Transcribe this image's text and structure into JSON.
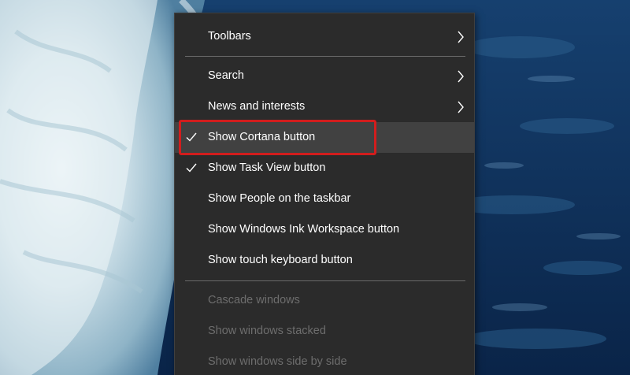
{
  "context_menu": {
    "items": [
      {
        "label": "Toolbars",
        "submenu": true
      },
      {
        "label": "Search",
        "submenu": true
      },
      {
        "label": "News and interests",
        "submenu": true
      },
      {
        "label": "Show Cortana button",
        "checked": true,
        "highlighted": true
      },
      {
        "label": "Show Task View button",
        "checked": true
      },
      {
        "label": "Show People on the taskbar"
      },
      {
        "label": "Show Windows Ink Workspace button"
      },
      {
        "label": "Show touch keyboard button"
      },
      {
        "label": "Cascade windows",
        "disabled": true
      },
      {
        "label": "Show windows stacked",
        "disabled": true
      },
      {
        "label": "Show windows side by side",
        "disabled": true
      }
    ]
  },
  "colors": {
    "menu_background": "#2b2b2b",
    "hover_background": "#414141",
    "text": "#ffffff",
    "disabled_text": "#6d6d6d",
    "annotation_outline": "#d21d1d"
  },
  "icons": {
    "check": "check-icon",
    "submenu": "chevron-right-icon"
  }
}
